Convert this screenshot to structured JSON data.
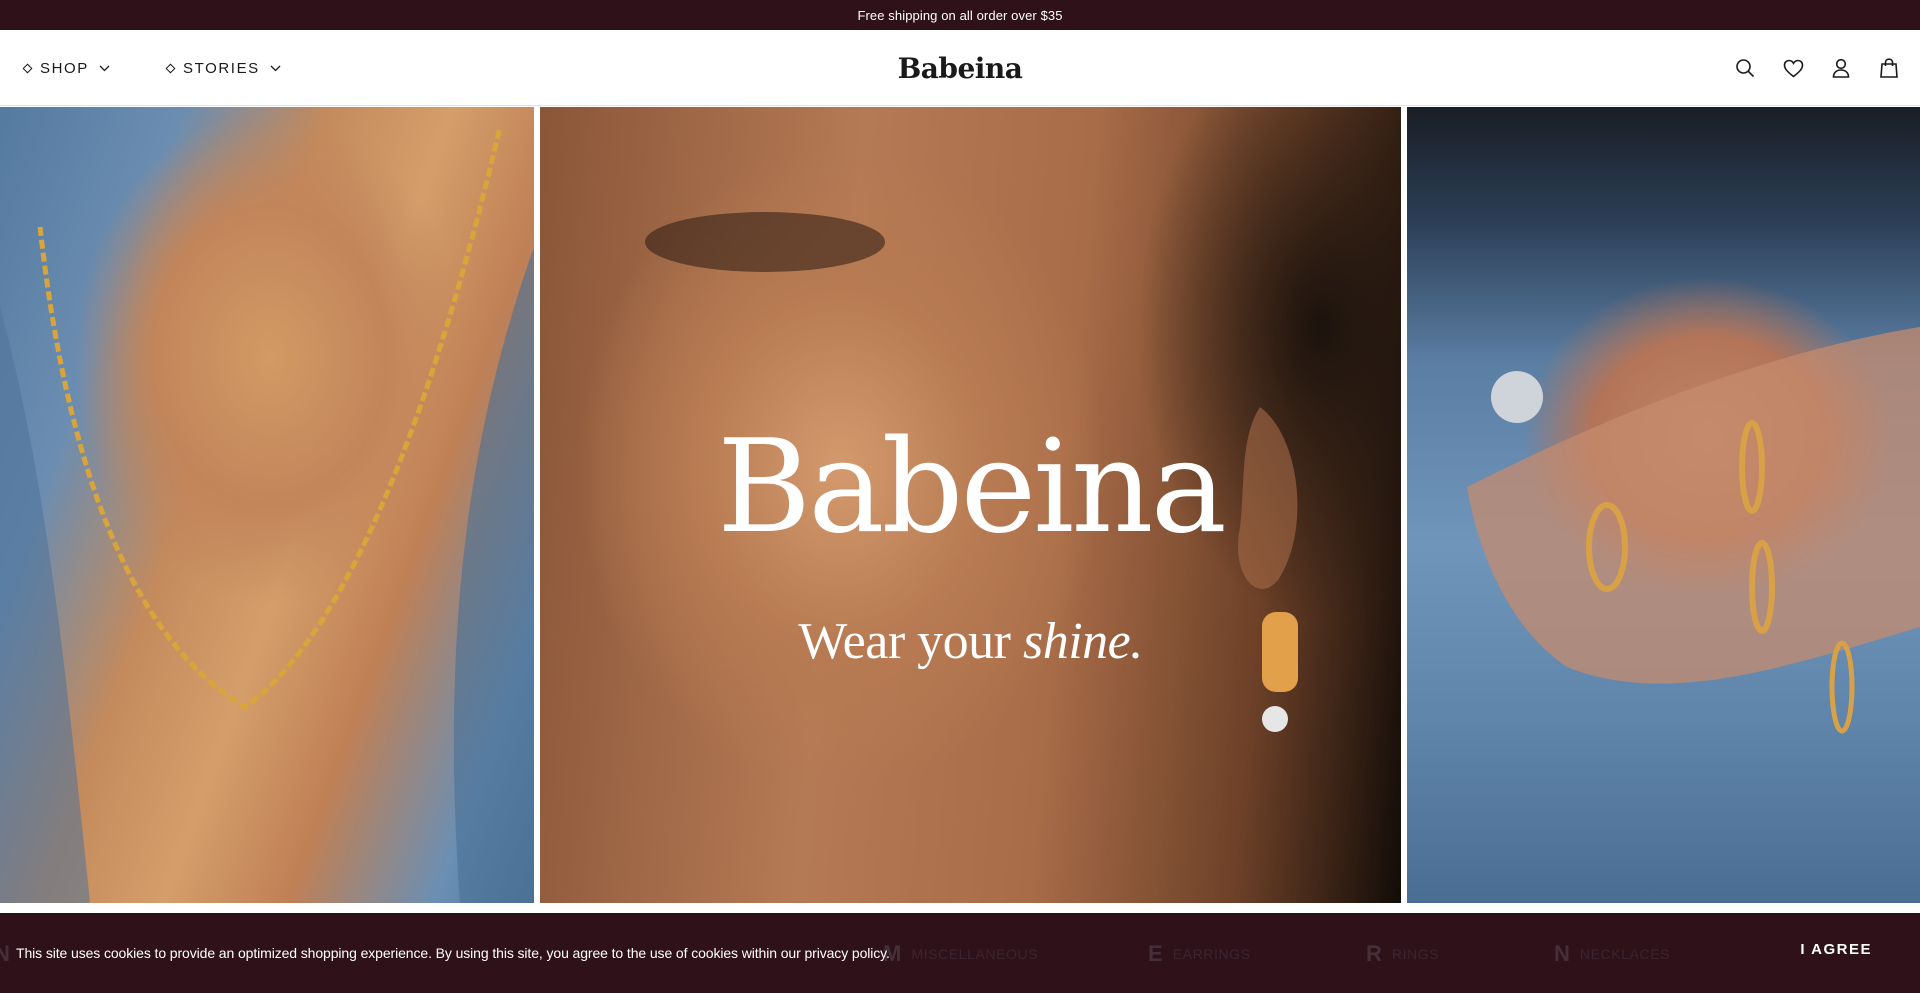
{
  "announcement": {
    "text": "Free shipping on all order over $35"
  },
  "header": {
    "nav": [
      {
        "label": "SHOP"
      },
      {
        "label": "STORIES"
      }
    ],
    "logo": "Babeina",
    "icons": [
      "search-icon",
      "heart-icon",
      "user-icon",
      "bag-icon"
    ]
  },
  "hero": {
    "brand": "Babeina",
    "tagline_start": "Wear your ",
    "tagline_emphasis": "shine."
  },
  "categories": [
    {
      "letter": "N",
      "name": ""
    },
    {
      "letter": "M",
      "name": "MISCELLANEOUS"
    },
    {
      "letter": "E",
      "name": "EARRINGS"
    },
    {
      "letter": "R",
      "name": "RINGS"
    },
    {
      "letter": "N",
      "name": "NECKLACES"
    }
  ],
  "cookie": {
    "text": "This site uses cookies to provide an optimized shopping experience. By using this site, you agree to the use of cookies within our privacy policy.",
    "button": "I AGREE"
  },
  "colors": {
    "brand_dark": "#2f1119",
    "text": "#1a1a1a",
    "white": "#ffffff"
  }
}
